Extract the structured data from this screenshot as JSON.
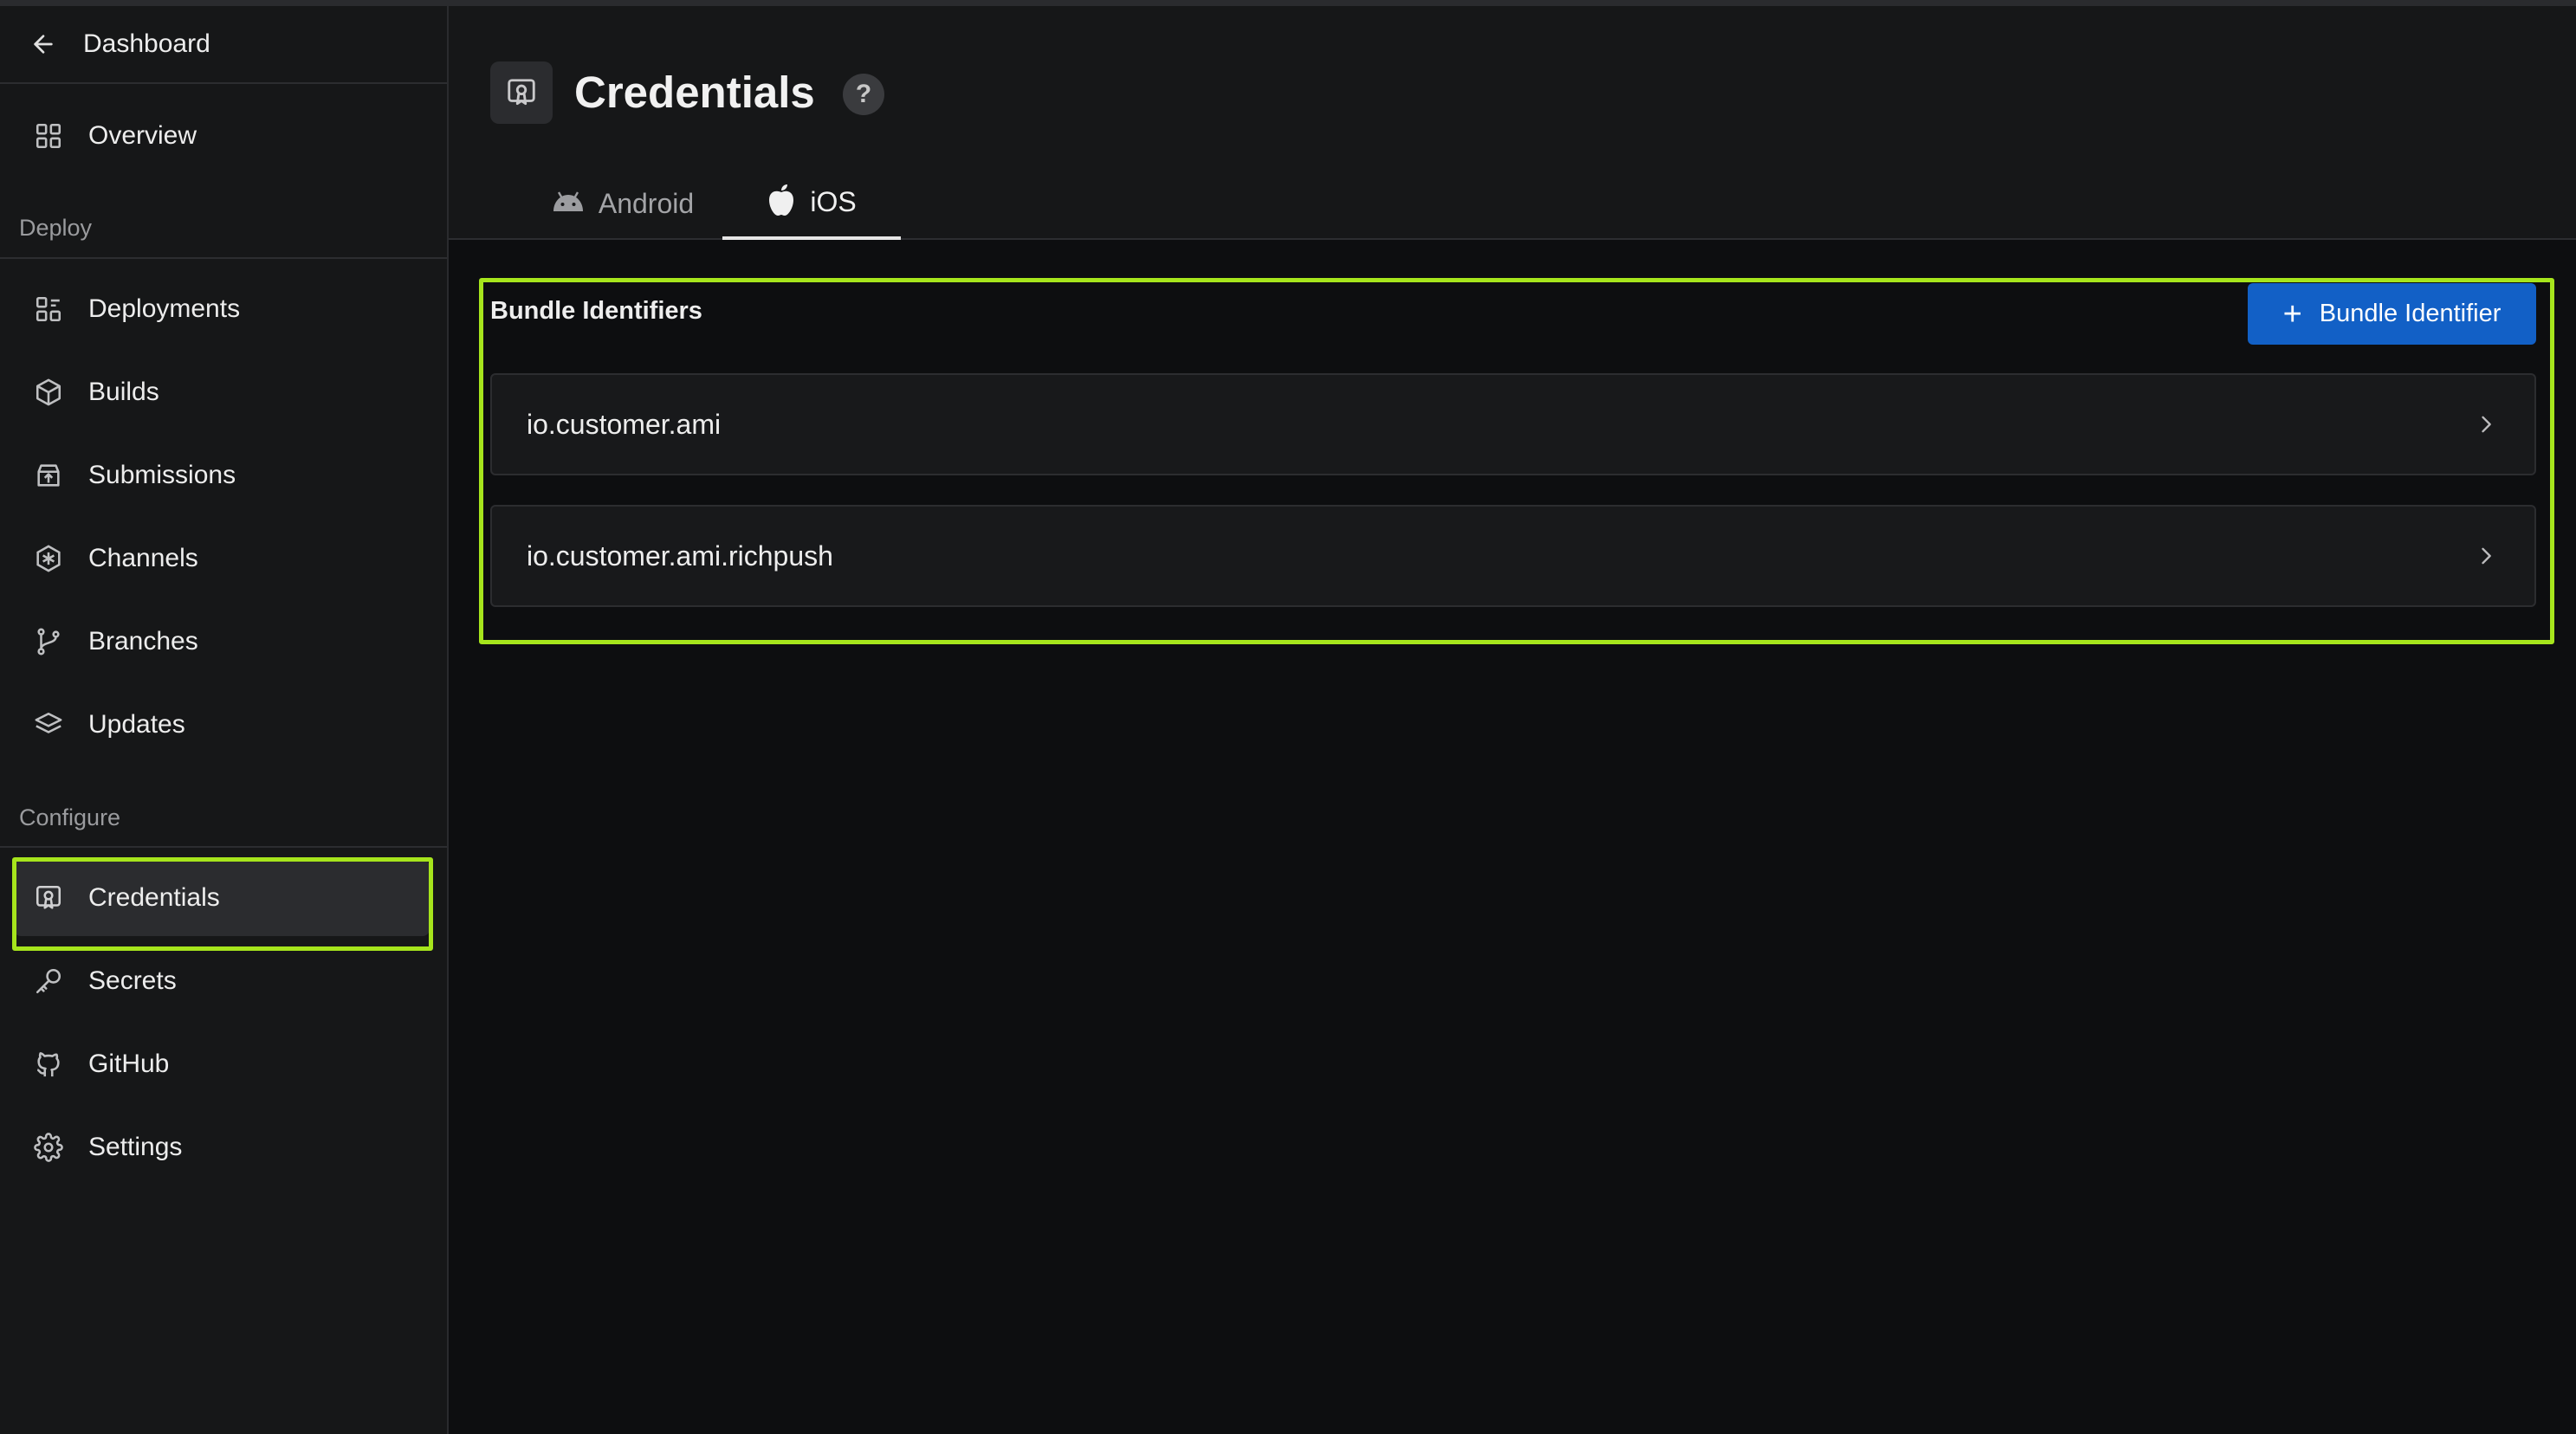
{
  "sidebar": {
    "back_label": "Dashboard",
    "overview_label": "Overview",
    "sections": {
      "deploy": "Deploy",
      "configure": "Configure"
    },
    "deploy_items": [
      {
        "label": "Deployments",
        "icon": "deployments-icon"
      },
      {
        "label": "Builds",
        "icon": "cube-icon"
      },
      {
        "label": "Submissions",
        "icon": "store-upload-icon"
      },
      {
        "label": "Channels",
        "icon": "channels-icon"
      },
      {
        "label": "Branches",
        "icon": "git-branch-icon"
      },
      {
        "label": "Updates",
        "icon": "layers-icon"
      }
    ],
    "configure_items": [
      {
        "label": "Credentials",
        "icon": "certificate-icon",
        "active": true
      },
      {
        "label": "Secrets",
        "icon": "key-icon"
      },
      {
        "label": "GitHub",
        "icon": "github-icon"
      },
      {
        "label": "Settings",
        "icon": "gear-icon"
      }
    ]
  },
  "header": {
    "title": "Credentials",
    "help": "?",
    "tabs": [
      {
        "label": "Android",
        "icon": "android-icon",
        "active": false
      },
      {
        "label": "iOS",
        "icon": "apple-icon",
        "active": true
      }
    ]
  },
  "bundles": {
    "title": "Bundle Identifiers",
    "add_button_label": "Bundle Identifier",
    "items": [
      {
        "label": "io.customer.ami"
      },
      {
        "label": "io.customer.ami.richpush"
      }
    ]
  },
  "colors": {
    "accent_blue": "#1260c6",
    "highlight_green": "#a6e51c",
    "background": "#0d0e10",
    "sidebar_bg": "#161718"
  }
}
